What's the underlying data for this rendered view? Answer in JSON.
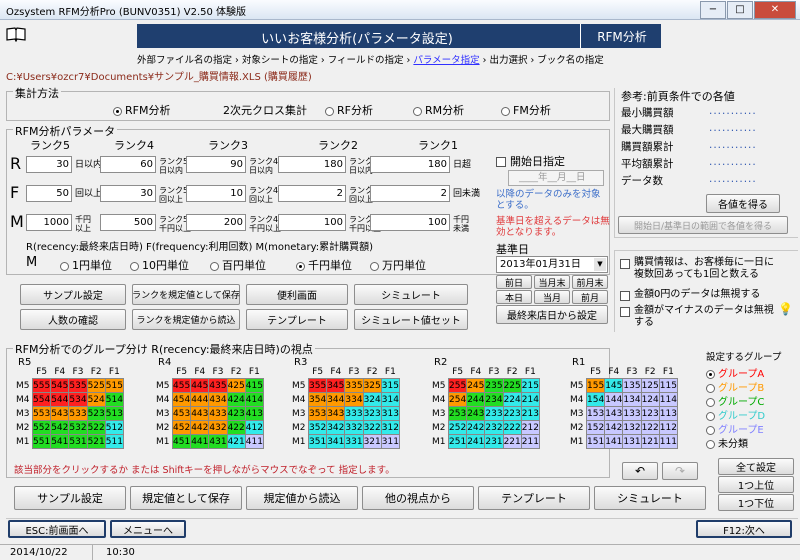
{
  "window": {
    "title": "Ozsystem RFM分析Pro (BUNV0351)  V2.50  体験版",
    "min": "−",
    "max": "□",
    "close": "✕"
  },
  "banner": {
    "title": "いいお客様分析(パラメータ設定)",
    "right": "RFM分析"
  },
  "nav": [
    {
      "label": "外部ファイル名の指定",
      "current": false
    },
    {
      "label": "対象シートの指定",
      "current": false
    },
    {
      "label": "フィールドの指定",
      "current": false
    },
    {
      "label": "パラメータ指定",
      "current": true
    },
    {
      "label": "出力選択",
      "current": false
    },
    {
      "label": "ブック名の指定",
      "current": false
    }
  ],
  "path": "C:¥Users¥ozcr7¥Documents¥サンプル_購買情報.XLS (購買履歴)",
  "method": {
    "title": "集計方法",
    "options": [
      "RFM分析",
      "2次元クロス集計",
      "RF分析",
      "RM分析",
      "FM分析"
    ],
    "selected": 0
  },
  "params": {
    "title": "RFM分析パラメータ",
    "ranks": [
      "ランク5",
      "ランク4",
      "ランク3",
      "ランク2",
      "ランク1"
    ],
    "rows": [
      {
        "letter": "R",
        "values": [
          "30",
          "60",
          "90",
          "180",
          "180"
        ],
        "notes": [
          "日以内",
          "ランク5超\n日以内",
          "ランク4超\n日以内",
          "ランク3超\n日以内",
          "日超"
        ]
      },
      {
        "letter": "F",
        "values": [
          "50",
          "30",
          "10",
          "2",
          "2"
        ],
        "notes": [
          "回以上",
          "ランク5未満\n回以上",
          "ランク4未満\n回以上",
          "ランク3未満\n回以上",
          "回未満"
        ]
      },
      {
        "letter": "M",
        "values": [
          "1000",
          "500",
          "200",
          "100",
          "100"
        ],
        "notes": [
          "千円\n以上",
          "ランク5未満\n千円以上",
          "ランク4未満\n千円以上",
          "ランク3未満\n千円以上",
          "千円\n未満"
        ]
      }
    ],
    "legend": "R(recency:最終来店日時)  F(frequency:利用回数)  M(monetary:累計購買額)",
    "m_label": "M",
    "m_units": [
      "1円単位",
      "10円単位",
      "百円単位",
      "千円単位",
      "万円単位"
    ],
    "m_selected": 3
  },
  "startdate": {
    "label": "開始日指定",
    "placeholder": "____年__月__日",
    "note1": "以降のデータのみを対象とする。",
    "note2": "基準日を超えるデータは無効となります。"
  },
  "basedate": {
    "label": "基準日",
    "value": "2013年01月31日",
    "buttons": [
      "前日",
      "当月末",
      "前月末",
      "本日",
      "当月",
      "前月"
    ],
    "from_last": "最終来店日から設定"
  },
  "actions": [
    "サンプル設定",
    "ランクを規定値として保存",
    "便利画面",
    "シミュレート",
    "人数の確認",
    "ランクを規定値から読込",
    "テンプレート",
    "シミュレート値セット"
  ],
  "ref": {
    "title": "参考:前頁条件での各値",
    "items": [
      "最小購買額",
      "最大購買額",
      "購買額累計",
      "平均額累計",
      "データ数"
    ],
    "dots": "...........",
    "get_btn": "各値を得る",
    "range_btn": "開始日/基準日の範囲で各値を得る"
  },
  "options": [
    "購買情報は、お客様毎に一日に複数回あっても1回と数える",
    "金額0円のデータは無視する",
    "金額がマイナスのデータは無視する"
  ],
  "matrix": {
    "title": "RFM分析でのグループ分け R(recency:最終来店日時)の視点",
    "col_headers": [
      "F5",
      "F4",
      "F3",
      "F2",
      "F1"
    ],
    "row_headers": [
      "M5",
      "M4",
      "M3",
      "M2",
      "M1"
    ],
    "blocks": [
      "R5",
      "R4",
      "R3",
      "R2",
      "R1"
    ],
    "hint": "該当部分をクリックするか または Shiftキーを押しながらマウスでなぞって 指定します。"
  },
  "groups": {
    "title": "設定するグループ",
    "items": [
      {
        "label": "グループA",
        "color": "#ff0000"
      },
      {
        "label": "グループB",
        "color": "#ff9900"
      },
      {
        "label": "グループC",
        "color": "#00aa00"
      },
      {
        "label": "グループD",
        "color": "#33cccc"
      },
      {
        "label": "グループE",
        "color": "#8080ff"
      },
      {
        "label": "未分類",
        "color": "#000000"
      }
    ],
    "selected": 0,
    "all_btn": "全て設定",
    "up_btn": "1つ上位",
    "down_btn": "1つ下位"
  },
  "bottom": [
    "サンプル設定",
    "規定値として保存",
    "規定値から読込",
    "他の視点から",
    "テンプレート",
    "シミュレート"
  ],
  "footer": {
    "esc": "ESC:前画面へ",
    "menu": "メニューへ",
    "f12": "F12:次へ"
  },
  "status": {
    "date": "2014/10/22",
    "time": "10:30"
  }
}
